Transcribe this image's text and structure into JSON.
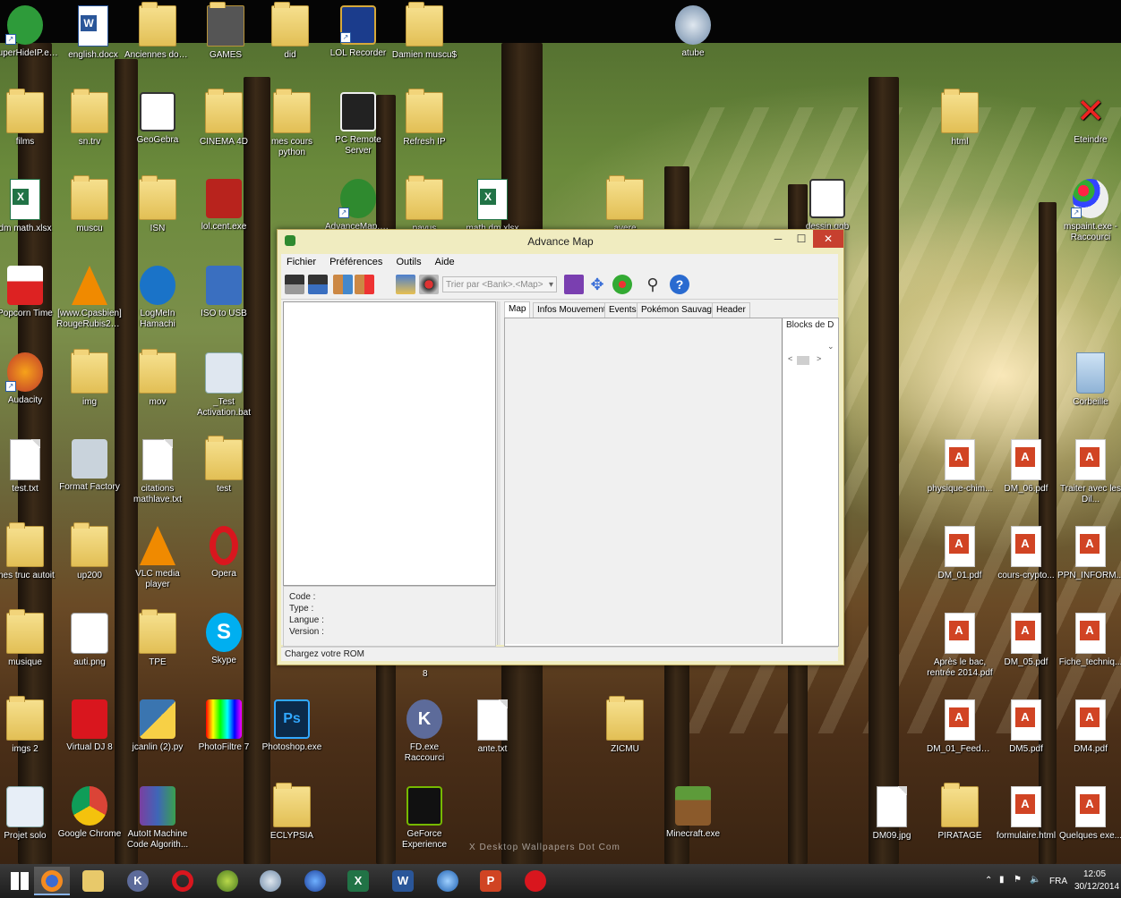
{
  "desktop": {
    "icons": [
      {
        "label": "SuperHideIP.exe - Raccourci",
        "type": "app"
      },
      {
        "label": "english.docx",
        "type": "word"
      },
      {
        "label": "Anciennes données",
        "type": "folder"
      },
      {
        "label": "GAMES",
        "type": "folder"
      },
      {
        "label": "did",
        "type": "folder"
      },
      {
        "label": "LOL Recorder",
        "type": "app"
      },
      {
        "label": "Damien muscu$",
        "type": "folder"
      },
      {
        "label": "atube",
        "type": "app"
      },
      {
        "label": "films",
        "type": "folder"
      },
      {
        "label": "sn.trv",
        "type": "folder"
      },
      {
        "label": "GeoGebra",
        "type": "app"
      },
      {
        "label": "CINEMA 4D",
        "type": "folder"
      },
      {
        "label": "mes cours python",
        "type": "folder"
      },
      {
        "label": "PC Remote Server",
        "type": "app"
      },
      {
        "label": "Refresh IP",
        "type": "folder"
      },
      {
        "label": "html",
        "type": "folder"
      },
      {
        "label": "Eteindre",
        "type": "app"
      },
      {
        "label": "dm math.xlsx",
        "type": "excel"
      },
      {
        "label": "muscu",
        "type": "folder"
      },
      {
        "label": "ISN",
        "type": "folder"
      },
      {
        "label": "lol.cent.exe",
        "type": "app"
      },
      {
        "label": "AdvanceMap.exe",
        "type": "app"
      },
      {
        "label": "pavus",
        "type": "folder"
      },
      {
        "label": "math.dm.xlsx",
        "type": "excel"
      },
      {
        "label": "avere",
        "type": "folder"
      },
      {
        "label": "dessin.ggb",
        "type": "app"
      },
      {
        "label": "mspaint.exe - Raccourci",
        "type": "app"
      },
      {
        "label": "Popcorn Time",
        "type": "app"
      },
      {
        "label": "[www.Cpasbien] RougeRubis20...",
        "type": "app"
      },
      {
        "label": "LogMeIn Hamachi",
        "type": "app"
      },
      {
        "label": "ISO to USB",
        "type": "app"
      },
      {
        "label": "Audacity",
        "type": "app"
      },
      {
        "label": "img",
        "type": "folder"
      },
      {
        "label": "mov",
        "type": "folder"
      },
      {
        "label": "_Test Activation.bat",
        "type": "app"
      },
      {
        "label": "Corbeille",
        "type": "app"
      },
      {
        "label": "test.txt",
        "type": "doc"
      },
      {
        "label": "Format Factory",
        "type": "app"
      },
      {
        "label": "citations mathlave.txt",
        "type": "doc"
      },
      {
        "label": "test",
        "type": "folder"
      },
      {
        "label": "physique-chim...",
        "type": "pdf"
      },
      {
        "label": "DM_06.pdf",
        "type": "pdf"
      },
      {
        "label": "Traiter avec les Dil...",
        "type": "pdf"
      },
      {
        "label": "mes truc autoit",
        "type": "folder"
      },
      {
        "label": "up200",
        "type": "folder"
      },
      {
        "label": "VLC media player",
        "type": "app"
      },
      {
        "label": "Opera",
        "type": "app"
      },
      {
        "label": "DM_01.pdf",
        "type": "pdf"
      },
      {
        "label": "cours-crypto...",
        "type": "pdf"
      },
      {
        "label": "PPN_INFORM...",
        "type": "pdf"
      },
      {
        "label": "musique",
        "type": "folder"
      },
      {
        "label": "auti.png",
        "type": "app"
      },
      {
        "label": "TPE",
        "type": "folder"
      },
      {
        "label": "Skype",
        "type": "app"
      },
      {
        "label": "Après le bac, rentrée 2014.pdf",
        "type": "pdf"
      },
      {
        "label": "DM_05.pdf",
        "type": "pdf"
      },
      {
        "label": "Fiche_techniq...",
        "type": "pdf"
      },
      {
        "label": "imgs 2",
        "type": "folder"
      },
      {
        "label": "Virtual DJ 8",
        "type": "app"
      },
      {
        "label": "jcanlin (2).py",
        "type": "app"
      },
      {
        "label": "PhotoFiltre 7",
        "type": "app"
      },
      {
        "label": "Photoshop.exe",
        "type": "app"
      },
      {
        "label": "FD.exe Raccourci",
        "type": "app"
      },
      {
        "label": "ante.txt",
        "type": "doc"
      },
      {
        "label": "ZICMU",
        "type": "folder"
      },
      {
        "label": "DM_01_Feedba...",
        "type": "pdf"
      },
      {
        "label": "DM5.pdf",
        "type": "pdf"
      },
      {
        "label": "DM4.pdf",
        "type": "pdf"
      },
      {
        "label": "Projet solo",
        "type": "app"
      },
      {
        "label": "Google Chrome",
        "type": "app"
      },
      {
        "label": "AutoIt Machine Code Algorith...",
        "type": "app"
      },
      {
        "label": "ECLYPSIA",
        "type": "folder"
      },
      {
        "label": "GeForce Experience",
        "type": "app"
      },
      {
        "label": "Minecraft.exe",
        "type": "app"
      },
      {
        "label": "DM09.jpg",
        "type": "doc"
      },
      {
        "label": "PIRATAGE",
        "type": "folder"
      },
      {
        "label": "formulaire.html",
        "type": "pdf"
      },
      {
        "label": "Quelques exe...",
        "type": "pdf"
      }
    ],
    "watermark": "X Desktop Wallpapers Dot Com",
    "stray_label": "8"
  },
  "window": {
    "title": "Advance Map",
    "menu": [
      "Fichier",
      "Préférences",
      "Outils",
      "Aide"
    ],
    "combo_placeholder": "Trier par <Bank>.<Map>",
    "combo_arrow": "▾",
    "tabs": [
      "Map",
      "Infos Mouvements",
      "Events",
      "Pokémon Sauvages",
      "Header"
    ],
    "blocks_label": "Blocks de D",
    "info": {
      "code": "Code :",
      "type": "Type :",
      "langue": "Langue :",
      "version": "Version :"
    },
    "status": "Chargez votre ROM"
  },
  "taskbar": {
    "language": "FRA",
    "time": "12:05",
    "date": "30/12/2014"
  }
}
